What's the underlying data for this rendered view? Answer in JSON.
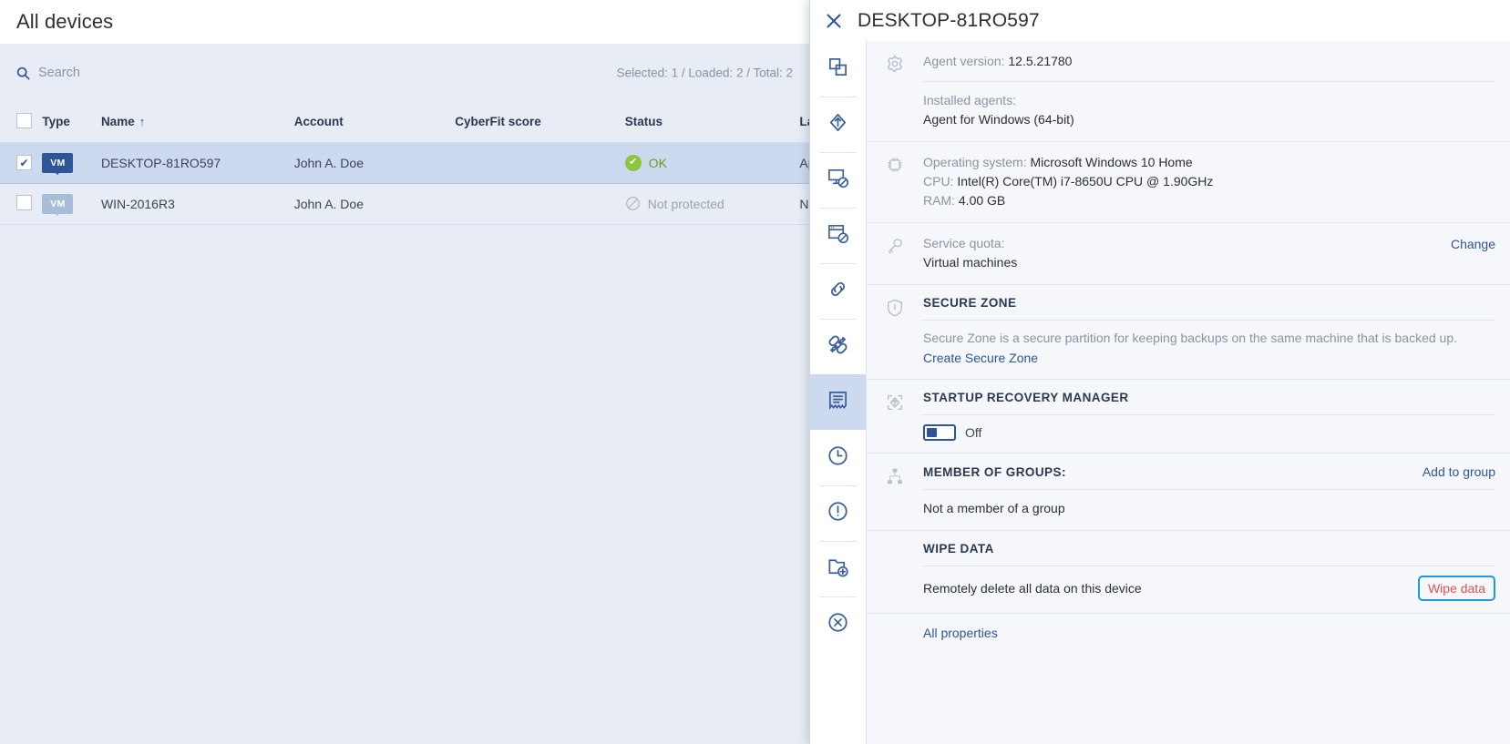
{
  "list": {
    "page_title": "All devices",
    "search": {
      "placeholder": "Search",
      "icon": "search-icon"
    },
    "counts": "Selected: 1 / Loaded: 2 / Total: 2",
    "columns": [
      "Type",
      "Name",
      "Account",
      "CyberFit score",
      "Status",
      "Last backup"
    ],
    "sort_column": "Name",
    "sort_arrow": "↑",
    "rows": [
      {
        "selected": true,
        "type_badge": "VM",
        "name": "DESKTOP-81RO597",
        "account": "John A. Doe",
        "cyberfit_score": "",
        "status": "OK",
        "status_kind": "ok",
        "last_backup": "Ap"
      },
      {
        "selected": false,
        "type_badge": "VM",
        "name": "WIN-2016R3",
        "account": "John A. Doe",
        "cyberfit_score": "",
        "status": "Not protected",
        "status_kind": "none",
        "last_backup": "Ne"
      }
    ]
  },
  "panel": {
    "title": "DESKTOP-81RO597",
    "close_icon": "close-icon",
    "rail": [
      {
        "name": "overview-icon",
        "active": false
      },
      {
        "name": "recovery-icon",
        "active": false
      },
      {
        "name": "disable-machine-icon",
        "active": false
      },
      {
        "name": "disable-window-icon",
        "active": false
      },
      {
        "name": "link-icon",
        "active": false
      },
      {
        "name": "patch-icon",
        "active": false
      },
      {
        "name": "details-icon",
        "active": true
      },
      {
        "name": "clock-icon",
        "active": false
      },
      {
        "name": "alerts-icon",
        "active": false
      },
      {
        "name": "add-folder-icon",
        "active": false
      },
      {
        "name": "remove-icon",
        "active": false
      }
    ],
    "sections": {
      "agent": {
        "icon": "gear-icon",
        "agent_version_label": "Agent version:",
        "agent_version_value": "12.5.21780",
        "installed_agents_label": "Installed agents:",
        "installed_agents_value": "Agent for Windows (64-bit)"
      },
      "system": {
        "icon": "cpu-icon",
        "os_label": "Operating system:",
        "os_value": "Microsoft Windows 10 Home",
        "cpu_label": "CPU:",
        "cpu_value": "Intel(R) Core(TM) i7-8650U CPU @ 1.90GHz",
        "ram_label": "RAM:",
        "ram_value": "4.00 GB"
      },
      "quota": {
        "icon": "key-icon",
        "label": "Service quota:",
        "value": "Virtual machines",
        "action": "Change"
      },
      "secure_zone": {
        "icon": "shield-icon",
        "heading": "SECURE ZONE",
        "description": "Secure Zone is a secure partition for keeping backups on the same machine that is backed up.",
        "action": "Create Secure Zone"
      },
      "startup_recovery": {
        "icon": "startup-recovery-icon",
        "heading": "STARTUP RECOVERY MANAGER",
        "toggle_state": "Off"
      },
      "groups": {
        "icon": "group-icon",
        "heading": "MEMBER OF GROUPS:",
        "action": "Add to group",
        "value": "Not a member of a group"
      },
      "wipe": {
        "heading": "WIPE DATA",
        "description": "Remotely delete all data on this device",
        "action": "Wipe data"
      },
      "footer": {
        "all_properties": "All properties"
      }
    }
  },
  "colors": {
    "accent": "#2f5596",
    "selected_row": "#ccd9ee",
    "status_ok": "#8cc63e",
    "danger": "#d9534f",
    "focus_ring": "#1b9ae0",
    "list_bg": "#e7ecf5",
    "panel_bg": "#f5f7fa"
  }
}
